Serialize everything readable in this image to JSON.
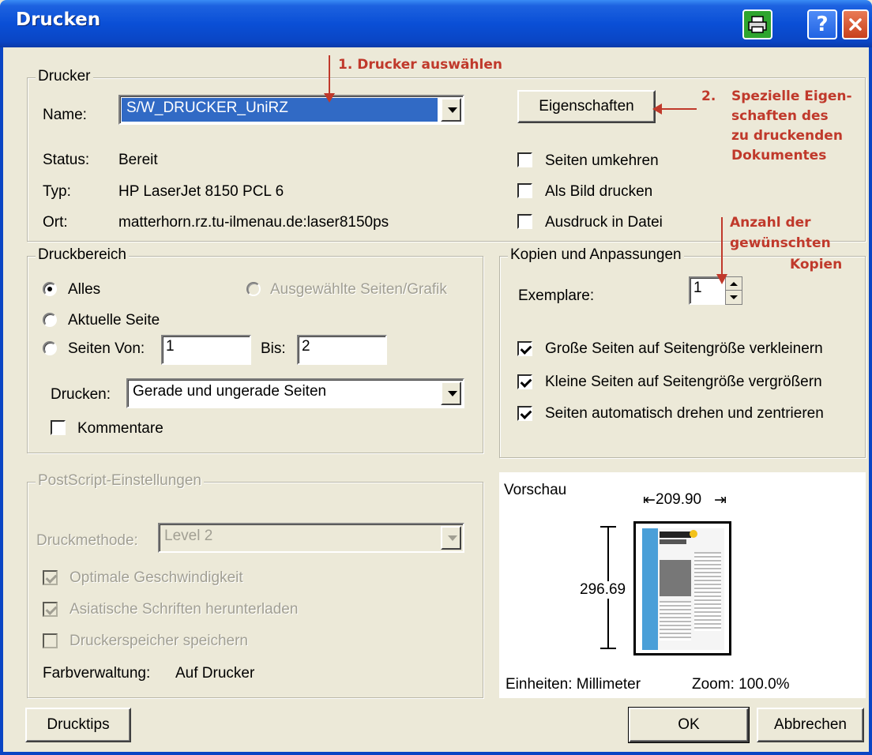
{
  "window": {
    "title": "Drucken",
    "help_label": "?"
  },
  "printer": {
    "group_label": "Drucker",
    "name_label": "Name:",
    "name_value": "S/W_DRUCKER_UniRZ",
    "properties_button": "Eigenschaften",
    "status_label": "Status:",
    "status_value": "Bereit",
    "type_label": "Typ:",
    "type_value": "HP LaserJet 8150 PCL 6",
    "location_label": "Ort:",
    "location_value": "matterhorn.rz.tu-ilmenau.de:laser8150ps",
    "options": [
      {
        "label": "Seiten umkehren",
        "checked": false
      },
      {
        "label": "Als Bild drucken",
        "checked": false
      },
      {
        "label": "Ausdruck in Datei",
        "checked": false
      }
    ]
  },
  "annotations": {
    "step1": "1.  Drucker auswählen",
    "step2_num": "2.",
    "step2_lines": [
      "Spezielle Eigen-",
      "schaften des",
      "zu druckenden",
      "Dokumentes"
    ],
    "copies_lines": [
      "Anzahl der",
      "gewünschten",
      "Kopien"
    ],
    "color": "#c0392b"
  },
  "range": {
    "group_label": "Druckbereich",
    "all_label": "Alles",
    "selected_label": "Ausgewählte Seiten/Grafik",
    "current_label": "Aktuelle Seite",
    "pages_label": "Seiten Von:",
    "from_value": "1",
    "to_label": "Bis:",
    "to_value": "2",
    "print_label": "Drucken:",
    "print_value": "Gerade und ungerade Seiten",
    "comments_label": "Kommentare",
    "selected": "all"
  },
  "copies": {
    "group_label": "Kopien und Anpassungen",
    "count_label": "Exemplare:",
    "count_value": "1",
    "options": [
      {
        "label": "Große Seiten auf Seitengröße verkleinern",
        "checked": true
      },
      {
        "label": "Kleine Seiten auf Seitengröße vergrößern",
        "checked": true
      },
      {
        "label": "Seiten automatisch drehen und zentrieren",
        "checked": true
      }
    ]
  },
  "postscript": {
    "group_label": "PostScript-Einstellungen",
    "method_label": "Druckmethode:",
    "method_value": "Level 2",
    "options": [
      {
        "label": "Optimale Geschwindigkeit",
        "checked": true
      },
      {
        "label": "Asiatische Schriften herunterladen",
        "checked": true
      },
      {
        "label": "Druckerspeicher speichern",
        "checked": false
      }
    ],
    "color_label": "Farbverwaltung:",
    "color_value": "Auf Drucker"
  },
  "preview": {
    "label": "Vorschau",
    "width": "209.90",
    "height": "296.69",
    "units": "Einheiten: Millimeter",
    "zoom": "Zoom: 100.0%"
  },
  "buttons": {
    "tips": "Drucktips",
    "ok": "OK",
    "cancel": "Abbrechen"
  }
}
